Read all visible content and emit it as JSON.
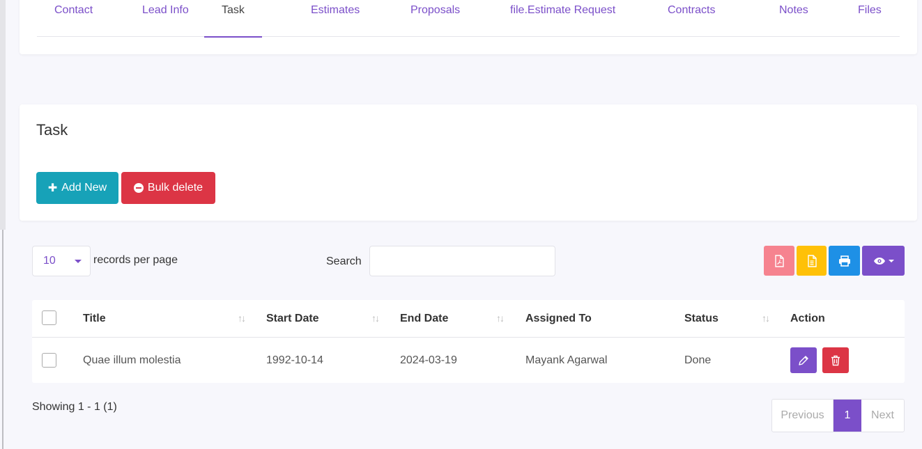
{
  "tabs": [
    {
      "label": "Contact"
    },
    {
      "label": "Lead Info"
    },
    {
      "label": "Task"
    },
    {
      "label": "Estimates"
    },
    {
      "label": "Proposals"
    },
    {
      "label": "file.Estimate Request"
    },
    {
      "label": "Contracts"
    },
    {
      "label": "Notes"
    },
    {
      "label": "Files"
    }
  ],
  "active_tab": "Task",
  "task_card": {
    "title": "Task",
    "add_new_label": "Add New",
    "bulk_delete_label": "Bulk delete"
  },
  "controls": {
    "per_page_value": "10",
    "per_page_label": "records per page",
    "search_label": "Search",
    "search_value": ""
  },
  "export_icons": [
    "pdf-file-icon",
    "csv-file-icon",
    "print-icon",
    "eye-icon"
  ],
  "table": {
    "headers": {
      "title": "Title",
      "start_date": "Start Date",
      "end_date": "End Date",
      "assigned_to": "Assigned To",
      "status": "Status",
      "action": "Action"
    },
    "rows": [
      {
        "title": "Quae illum molestia",
        "start_date": "1992-10-14",
        "end_date": "2024-03-19",
        "assigned_to": "Mayank Agarwal",
        "status": "Done"
      }
    ]
  },
  "footer": {
    "showing": "Showing 1 - 1 (1)",
    "prev_label": "Previous",
    "current_page": "1",
    "next_label": "Next"
  },
  "colors": {
    "accent": "#7b4fc9",
    "info": "#17a2b8",
    "danger": "#dc3545",
    "pdf": "#f6838f",
    "csv": "#ffc107",
    "print": "#1e90e6"
  }
}
